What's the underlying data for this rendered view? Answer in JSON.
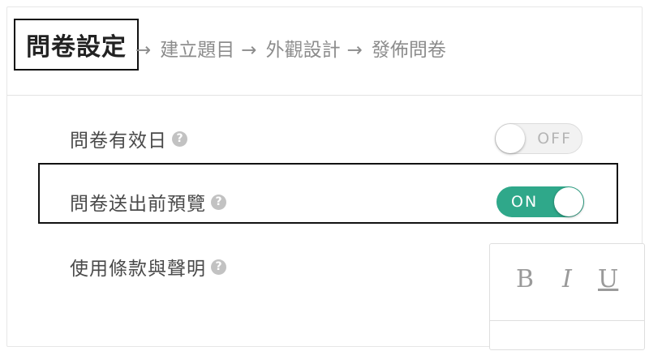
{
  "wizard": {
    "current_step": "問卷設定",
    "arrow": "→",
    "next_steps": [
      "建立題目",
      "外觀設計",
      "發佈問卷"
    ]
  },
  "settings": [
    {
      "label": "問卷有效日",
      "help": "?",
      "toggle": "OFF",
      "enabled": false
    },
    {
      "label": "問卷送出前預覽",
      "help": "?",
      "toggle": "ON",
      "enabled": true
    },
    {
      "label": "使用條款與聲明",
      "help": "?"
    }
  ],
  "editor": {
    "bold": "B",
    "italic": "I",
    "underline": "U"
  },
  "colors": {
    "toggle_on": "#2fa88a",
    "toggle_off": "#f2f2f2"
  }
}
